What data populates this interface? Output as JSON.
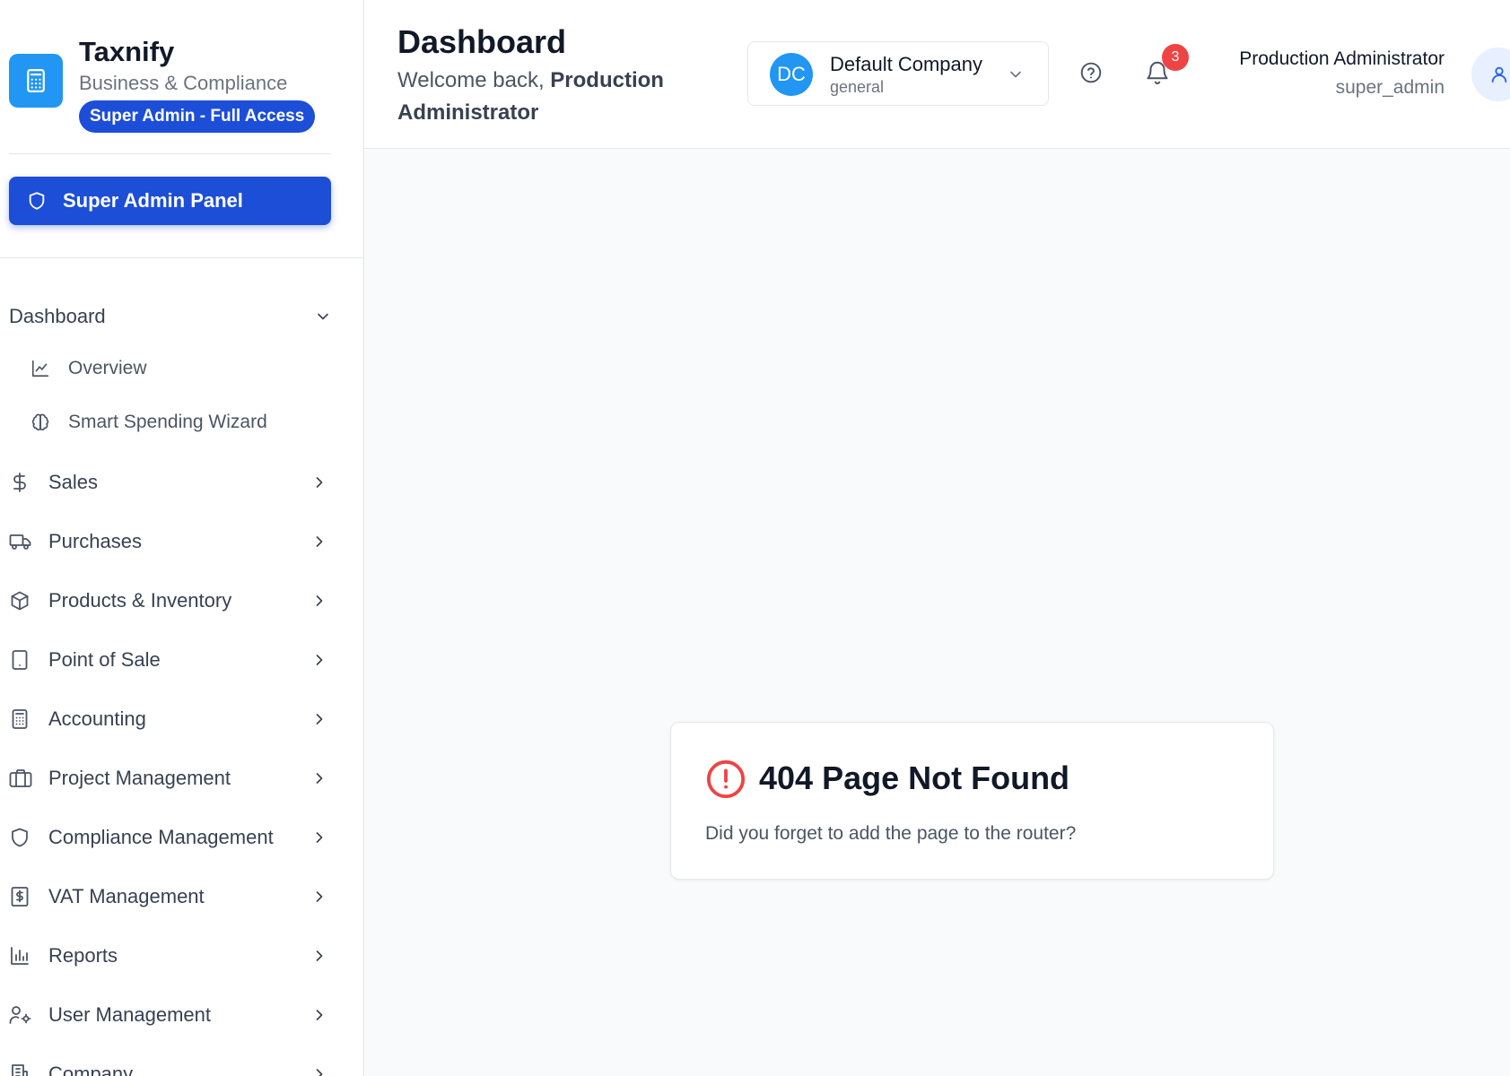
{
  "brand": {
    "name": "Taxnify",
    "subtitle": "Business & Compliance",
    "badge": "Super Admin - Full Access"
  },
  "admin_panel": {
    "label": "Super Admin Panel"
  },
  "sidebar": {
    "section": {
      "label": "Dashboard",
      "expanded": true
    },
    "sub_items": [
      {
        "label": "Overview",
        "icon": "line-chart-icon"
      },
      {
        "label": "Smart Spending Wizard",
        "icon": "brain-icon"
      }
    ],
    "items": [
      {
        "label": "Sales",
        "icon": "dollar-icon"
      },
      {
        "label": "Purchases",
        "icon": "truck-icon"
      },
      {
        "label": "Products & Inventory",
        "icon": "box-icon"
      },
      {
        "label": "Point of Sale",
        "icon": "tablet-icon"
      },
      {
        "label": "Accounting",
        "icon": "calculator-icon"
      },
      {
        "label": "Project Management",
        "icon": "briefcase-icon"
      },
      {
        "label": "Compliance Management",
        "icon": "shield-icon"
      },
      {
        "label": "VAT Management",
        "icon": "receipt-icon"
      },
      {
        "label": "Reports",
        "icon": "bar-chart-icon"
      },
      {
        "label": "User Management",
        "icon": "user-cog-icon"
      },
      {
        "label": "Company",
        "icon": "building-icon"
      }
    ]
  },
  "header": {
    "title": "Dashboard",
    "welcome_prefix": "Welcome back, ",
    "welcome_name": "Production Administrator",
    "company": {
      "initials": "DC",
      "name": "Default Company",
      "type": "general"
    },
    "notifications": {
      "count": "3"
    },
    "user": {
      "name": "Production Administrator",
      "role": "super_admin"
    }
  },
  "error": {
    "title": "404 Page Not Found",
    "message": "Did you forget to add the page to the router?"
  },
  "colors": {
    "primary": "#1d4ed8",
    "brand_logo": "#2196f3",
    "danger": "#ef4444",
    "background": "#f9fafb"
  }
}
